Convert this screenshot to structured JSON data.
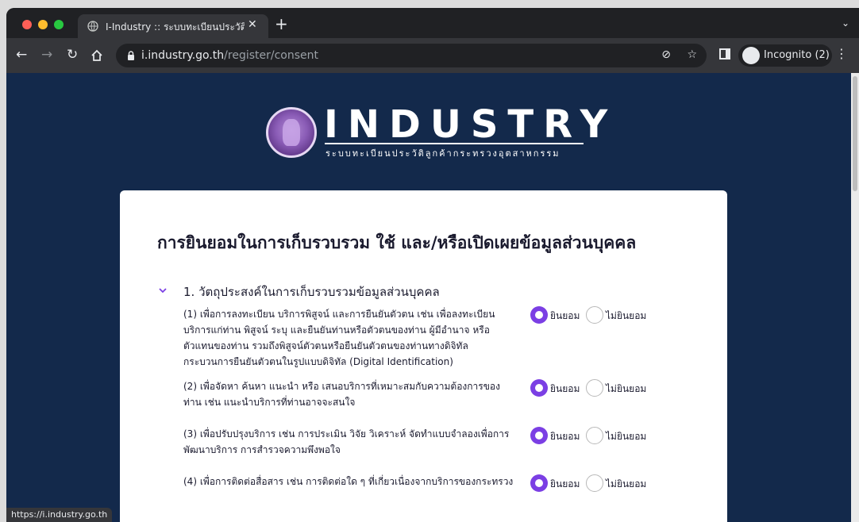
{
  "browser": {
    "tab_title": "I-Industry :: ระบบทะเบียนประวัติลู",
    "close_glyph": "✕",
    "new_tab_glyph": "+",
    "tab_menu_glyph": "⌄",
    "url_domain": "i.industry.go.th",
    "url_path": "/register/consent",
    "incognito_label": "Incognito (2)",
    "status_text": "https://i.industry.go.th"
  },
  "logo": {
    "wordmark": "INDUSTRY",
    "subtitle": "ระบบทะเบียนประวัติลูกค้ากระทรวงอุตสาหกรรม"
  },
  "consent_page": {
    "title": "การยินยอมในการเก็บรวบรวม ใช้ และ/หรือเปิดเผยข้อมูลส่วนบุคคล",
    "section_title": "1. วัตถุประสงค์ในการเก็บรวบรวมข้อมูลส่วนบุคคล",
    "accept_label": "ยินยอม",
    "decline_label": "ไม่ยินยอม",
    "items": [
      {
        "text": "(1) เพื่อการลงทะเบียน บริการพิสูจน์ และการยืนยันตัวตน เช่น เพื่อลงทะเบียนบริการแก่ท่าน พิสูจน์ ระบุ และยืนยันท่านหรือตัวตนของท่าน ผู้มีอำนาจ หรือตัวแทนของท่าน รวมถึงพิสูจน์ตัวตนหรือยืนยันตัวตนของท่านทางดิจิทัล กระบวนการยืนยันตัวตนในรูปแบบดิจิทัล (Digital Identification)",
        "selected": "accept"
      },
      {
        "text": "(2) เพื่อจัดหา ค้นหา แนะนำ หรือ เสนอบริการที่เหมาะสมกับความต้องการของท่าน เช่น แนะนำบริการที่ท่านอาจจะสนใจ",
        "selected": "accept"
      },
      {
        "text": "(3) เพื่อปรับปรุงบริการ เช่น การประเมิน วิจัย วิเคราะห์ จัดทำแบบจำลองเพื่อการพัฒนาบริการ การสำรวจความพึงพอใจ",
        "selected": "accept"
      },
      {
        "text": "(4) เพื่อการติดต่อสื่อสาร เช่น การติดต่อใด ๆ ที่เกี่ยวเนื่องจากบริการของกระทรวง",
        "selected": "accept"
      }
    ]
  },
  "colors": {
    "page_background": "#13294b",
    "accent": "#7b3fe4"
  }
}
